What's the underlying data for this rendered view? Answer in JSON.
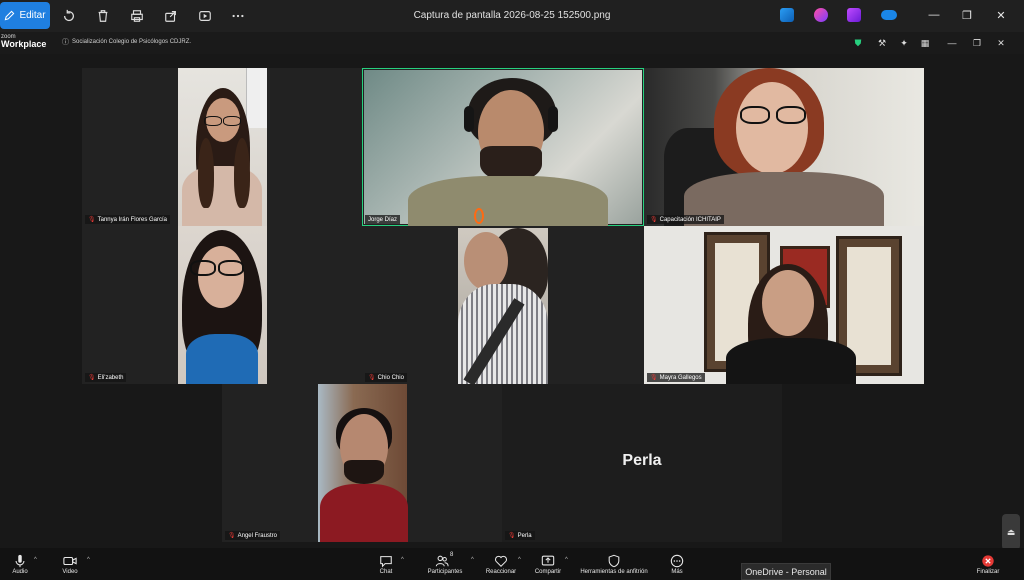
{
  "photos": {
    "edit_label": "Editar",
    "file_title": "Captura de pantalla 2026-08-25 152500.png"
  },
  "zoom": {
    "logo_top": "zoom",
    "logo_bottom": "Workplace",
    "meeting_name": "Socialización Colegio de Psicólogos CDJRZ."
  },
  "participants": [
    {
      "name": "Tannya Irán Flores García"
    },
    {
      "name": "Jorge Díaz"
    },
    {
      "name": "Capacitación ICHITAIP"
    },
    {
      "name": "Eli'zabeth"
    },
    {
      "name": "Chio Chio"
    },
    {
      "name": "Mayra Gallegos"
    },
    {
      "name": "Angel Fraustro"
    },
    {
      "name": "Perla"
    }
  ],
  "perla_display": "Perla",
  "toolbar": {
    "audio": "Audio",
    "video": "Video",
    "chat": "Chat",
    "participants": "Participantes",
    "participants_count": "8",
    "react": "Reaccionar",
    "share": "Compartir",
    "host_tools": "Herramientas de anfitrión",
    "more": "Más",
    "end": "Finalizar"
  },
  "tooltip": "OneDrive - Personal",
  "colors": {
    "accent_edit": "#1f7fe0",
    "active_speaker": "#27d07f",
    "end_red": "#e53935"
  }
}
